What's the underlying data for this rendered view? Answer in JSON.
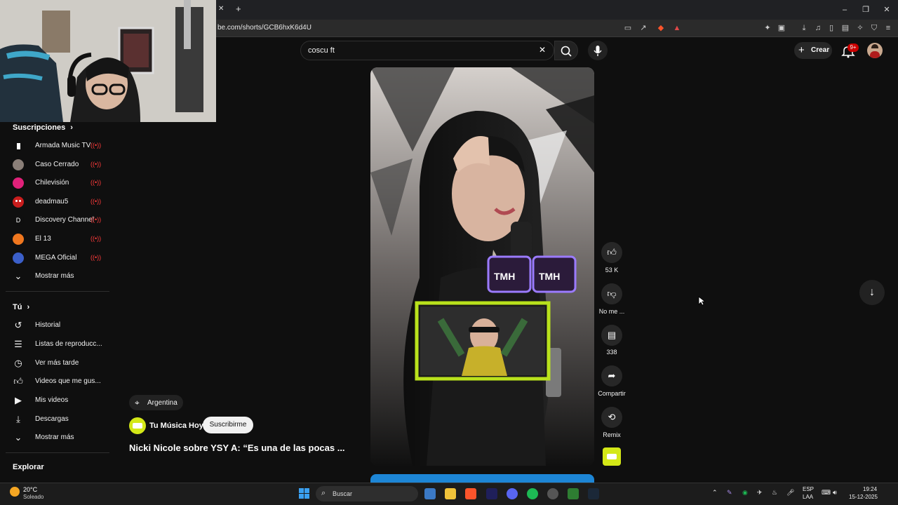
{
  "browser": {
    "url": "be.com/shorts/GCB6hxK6d4U",
    "tab_close": "✕",
    "new_tab": "+"
  },
  "search": {
    "query": "coscu ft",
    "clear_label": "✕"
  },
  "header": {
    "create_label": "Crear",
    "notif_count": "9+"
  },
  "sidebar": {
    "subs_title": "Suscripciones",
    "subscriptions": [
      {
        "name": "Armada Music TV"
      },
      {
        "name": "Caso Cerrado"
      },
      {
        "name": "Chilevisión"
      },
      {
        "name": "deadmau5"
      },
      {
        "name": "Discovery Channel"
      },
      {
        "name": "El 13"
      },
      {
        "name": "MEGA Oficial"
      }
    ],
    "live_mark": "((•))",
    "subs_more": "Mostrar más",
    "you_title": "Tú",
    "you_items": [
      {
        "label": "Historial",
        "icon": "history-icon"
      },
      {
        "label": "Listas de reproducc...",
        "icon": "playlist-icon"
      },
      {
        "label": "Ver más tarde",
        "icon": "clock-icon"
      },
      {
        "label": "Videos que me gus...",
        "icon": "like-icon"
      },
      {
        "label": "Mis videos",
        "icon": "video-icon"
      },
      {
        "label": "Descargas",
        "icon": "download-icon"
      }
    ],
    "you_more": "Mostrar más",
    "explore_title": "Explorar"
  },
  "short": {
    "location": "Argentina",
    "channel": "Tu Música Hoy",
    "subscribe": "Suscribirme",
    "title": "Nicki Nicole sobre YSY A: “Es una de las pocas ...",
    "actions": {
      "likes": "53 K",
      "dislike": "No me ...",
      "comments": "338",
      "share": "Compartir",
      "remix": "Remix"
    },
    "mic_text": "TMH"
  },
  "taskbar": {
    "weather_temp": "20°C",
    "weather_desc": "Soleado",
    "search_placeholder": "Buscar",
    "lang_top": "ESP",
    "lang_bottom": "LAA",
    "time": "19:24",
    "date": "15-12-2025"
  }
}
